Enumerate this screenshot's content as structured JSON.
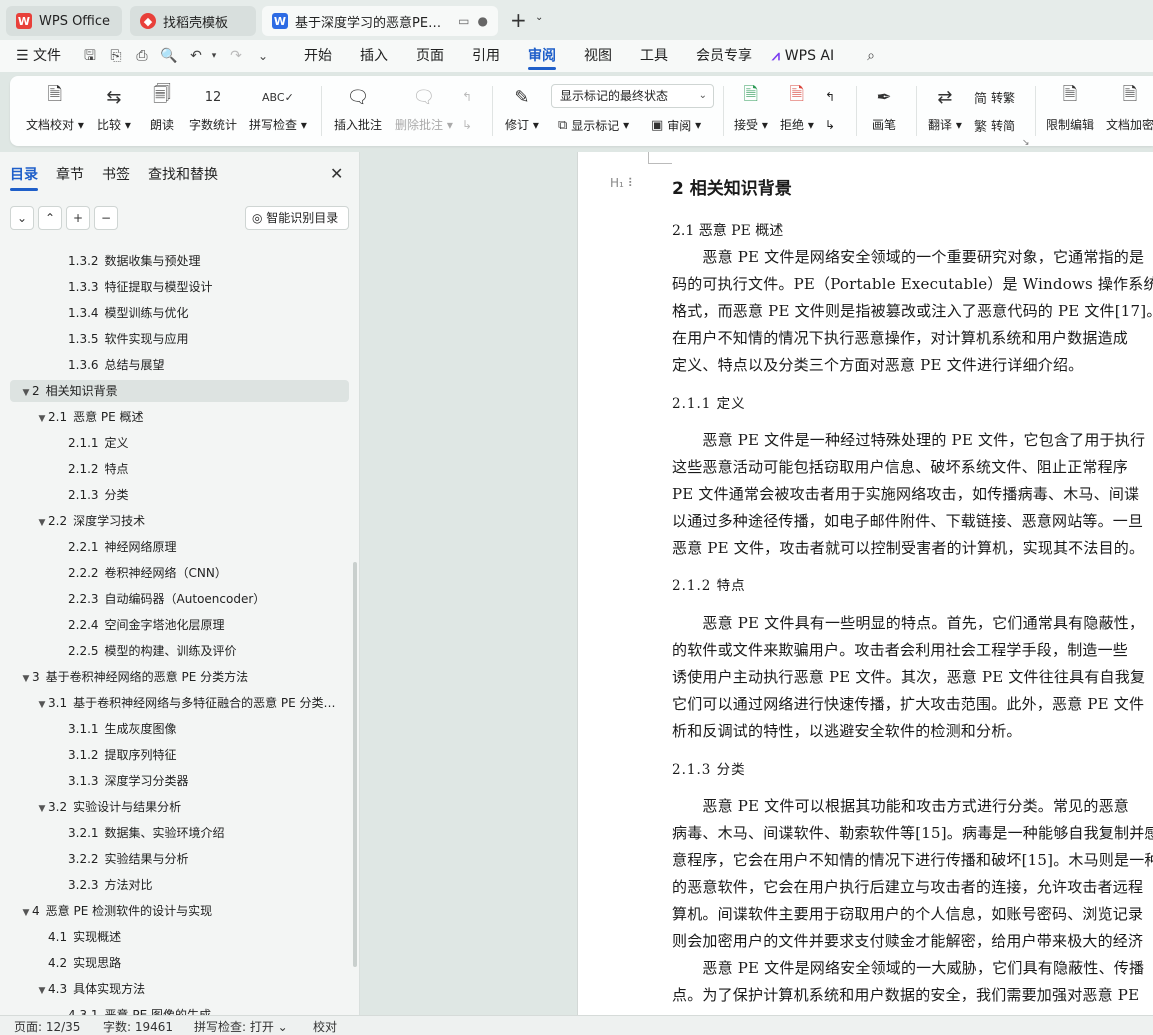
{
  "tabs": [
    {
      "label": "WPS Office",
      "icon": "wps-logo-icon"
    },
    {
      "label": "找稻壳模板",
      "icon": "docer-logo-icon"
    },
    {
      "label": "基于深度学习的恶意PE检测软…",
      "icon": "wps-writer-icon"
    }
  ],
  "menu": {
    "file": "文件",
    "items": [
      "开始",
      "插入",
      "页面",
      "引用",
      "审阅",
      "视图",
      "工具",
      "会员专享"
    ],
    "active": "审阅",
    "ai": "WPS AI"
  },
  "ribbon": {
    "doc_check": "文档校对",
    "compare": "比较",
    "read_aloud": "朗读",
    "word_count": "字数统计",
    "spell_check": "拼写检查",
    "insert_comment": "插入批注",
    "delete_comment": "删除批注",
    "track_changes": "修订",
    "markup_mode": "显示标记的最终状态",
    "show_markup": "显示标记",
    "review": "审阅",
    "accept": "接受",
    "reject": "拒绝",
    "pen": "画笔",
    "translate": "翻译",
    "to_traditional": "转繁",
    "to_simplified": "转简",
    "restrict_edit": "限制编辑",
    "doc_encrypt": "文档加密",
    "icon_zh_trad": "简",
    "icon_zh_simp": "繁"
  },
  "nav": {
    "tabs": [
      "目录",
      "章节",
      "书签",
      "查找和替换"
    ],
    "active_tab": "目录",
    "smart_toc": "智能识别目录",
    "toc": [
      {
        "num": "1.3.2",
        "title": "数据收集与预处理",
        "level": 3
      },
      {
        "num": "1.3.3",
        "title": "特征提取与模型设计",
        "level": 3
      },
      {
        "num": "1.3.4",
        "title": "模型训练与优化",
        "level": 3
      },
      {
        "num": "1.3.5",
        "title": "软件实现与应用",
        "level": 3
      },
      {
        "num": "1.3.6",
        "title": "总结与展望",
        "level": 3
      },
      {
        "num": "2",
        "title": "相关知识背景",
        "level": 1,
        "expanded": true,
        "selected": true
      },
      {
        "num": "2.1",
        "title": "恶意 PE 概述",
        "level": 2,
        "expanded": true
      },
      {
        "num": "2.1.1",
        "title": "定义",
        "level": 3
      },
      {
        "num": "2.1.2",
        "title": "特点",
        "level": 3
      },
      {
        "num": "2.1.3",
        "title": "分类",
        "level": 3
      },
      {
        "num": "2.2",
        "title": "深度学习技术",
        "level": 2,
        "expanded": true
      },
      {
        "num": "2.2.1",
        "title": "神经网络原理",
        "level": 3
      },
      {
        "num": "2.2.2",
        "title": "卷积神经网络（CNN）",
        "level": 3
      },
      {
        "num": "2.2.3",
        "title": "自动编码器（Autoencoder）",
        "level": 3
      },
      {
        "num": "2.2.4",
        "title": "空间金字塔池化层原理",
        "level": 3
      },
      {
        "num": "2.2.5",
        "title": "模型的构建、训练及评价",
        "level": 3
      },
      {
        "num": "3",
        "title": "基于卷积神经网络的恶意 PE 分类方法",
        "level": 1,
        "expanded": true
      },
      {
        "num": "3.1",
        "title": "基于卷积神经网络与多特征融合的恶意 PE 分类…",
        "level": 2,
        "expanded": true
      },
      {
        "num": "3.1.1",
        "title": "生成灰度图像",
        "level": 3
      },
      {
        "num": "3.1.2",
        "title": "提取序列特征",
        "level": 3
      },
      {
        "num": "3.1.3",
        "title": "深度学习分类器",
        "level": 3
      },
      {
        "num": "3.2",
        "title": "实验设计与结果分析",
        "level": 2,
        "expanded": true
      },
      {
        "num": "3.2.1",
        "title": "数据集、实验环境介绍",
        "level": 3
      },
      {
        "num": "3.2.2",
        "title": "实验结果与分析",
        "level": 3
      },
      {
        "num": "3.2.3",
        "title": "方法对比",
        "level": 3
      },
      {
        "num": "4",
        "title": "恶意 PE 检测软件的设计与实现",
        "level": 1,
        "expanded": true
      },
      {
        "num": "4.1",
        "title": "实现概述",
        "level": 2
      },
      {
        "num": "4.2",
        "title": "实现思路",
        "level": 2
      },
      {
        "num": "4.3",
        "title": "具体实现方法",
        "level": 2,
        "expanded": true
      },
      {
        "num": "4.3.1",
        "title": "恶意 PE 图像的生成",
        "level": 3
      }
    ]
  },
  "document": {
    "heading_marker": "H₁ ⠇",
    "lines": [
      {
        "style": "h1",
        "text": "2  相关知识背景"
      },
      {
        "style": "h2",
        "text": "2.1  恶意 PE 概述"
      },
      {
        "style": "body",
        "text": "　　恶意 PE 文件是网络安全领域的一个重要研究对象，它通常指的是"
      },
      {
        "style": "body",
        "text": "码的可执行文件。PE（Portable Executable）是 Windows 操作系统下的"
      },
      {
        "style": "body",
        "text": "格式，而恶意 PE 文件则是指被篡改或注入了恶意代码的 PE 文件[17]。"
      },
      {
        "style": "body",
        "text": "在用户不知情的情况下执行恶意操作，对计算机系统和用户数据造成"
      },
      {
        "style": "body",
        "text": "定义、特点以及分类三个方面对恶意 PE 文件进行详细介绍。"
      },
      {
        "style": "h3",
        "text": "2.1.1 定义"
      },
      {
        "style": "body",
        "text": "　　恶意 PE 文件是一种经过特殊处理的 PE 文件，它包含了用于执行"
      },
      {
        "style": "body",
        "text": "这些恶意活动可能包括窃取用户信息、破坏系统文件、阻止正常程序"
      },
      {
        "style": "body",
        "text": "PE 文件通常会被攻击者用于实施网络攻击，如传播病毒、木马、间谍"
      },
      {
        "style": "body",
        "text": "以通过多种途径传播，如电子邮件附件、下载链接、恶意网站等。一旦"
      },
      {
        "style": "body",
        "text": "恶意 PE 文件，攻击者就可以控制受害者的计算机，实现其不法目的。"
      },
      {
        "style": "h3",
        "text": "2.1.2 特点"
      },
      {
        "style": "body",
        "text": "　　恶意 PE 文件具有一些明显的特点。首先，它们通常具有隐蔽性，"
      },
      {
        "style": "body",
        "text": "的软件或文件来欺骗用户。攻击者会利用社会工程学手段，制造一些"
      },
      {
        "style": "body",
        "text": "诱使用户主动执行恶意 PE 文件。其次，恶意 PE 文件往往具有自我复"
      },
      {
        "style": "body",
        "text": "它们可以通过网络进行快速传播，扩大攻击范围。此外，恶意 PE 文件"
      },
      {
        "style": "body",
        "text": "析和反调试的特性，以逃避安全软件的检测和分析。"
      },
      {
        "style": "h3",
        "text": "2.1.3 分类"
      },
      {
        "style": "body",
        "text": "　　恶意 PE 文件可以根据其功能和攻击方式进行分类。常见的恶意"
      },
      {
        "style": "body",
        "text": "病毒、木马、间谍软件、勒索软件等[15]。病毒是一种能够自我复制并感"
      },
      {
        "style": "body",
        "text": "意程序，它会在用户不知情的情况下进行传播和破坏[15]。木马则是一种"
      },
      {
        "style": "body",
        "text": "的恶意软件，它会在用户执行后建立与攻击者的连接，允许攻击者远程"
      },
      {
        "style": "body",
        "text": "算机。间谍软件主要用于窃取用户的个人信息，如账号密码、浏览记录"
      },
      {
        "style": "body",
        "text": "则会加密用户的文件并要求支付赎金才能解密，给用户带来极大的经济"
      },
      {
        "style": "body",
        "text": "　　恶意 PE 文件是网络安全领域的一大威胁，它们具有隐蔽性、传播"
      },
      {
        "style": "body",
        "text": "点。为了保护计算机系统和用户数据的安全，我们需要加强对恶意 PE"
      }
    ]
  },
  "status": {
    "page": "页面: 12/35",
    "words": "字数: 19461",
    "spell": "拼写检查: 打开",
    "proof": "校对"
  },
  "colors": {
    "accent": "#1f5fc9",
    "wps_red": "#e8403a",
    "writer_blue": "#2d6be4"
  }
}
